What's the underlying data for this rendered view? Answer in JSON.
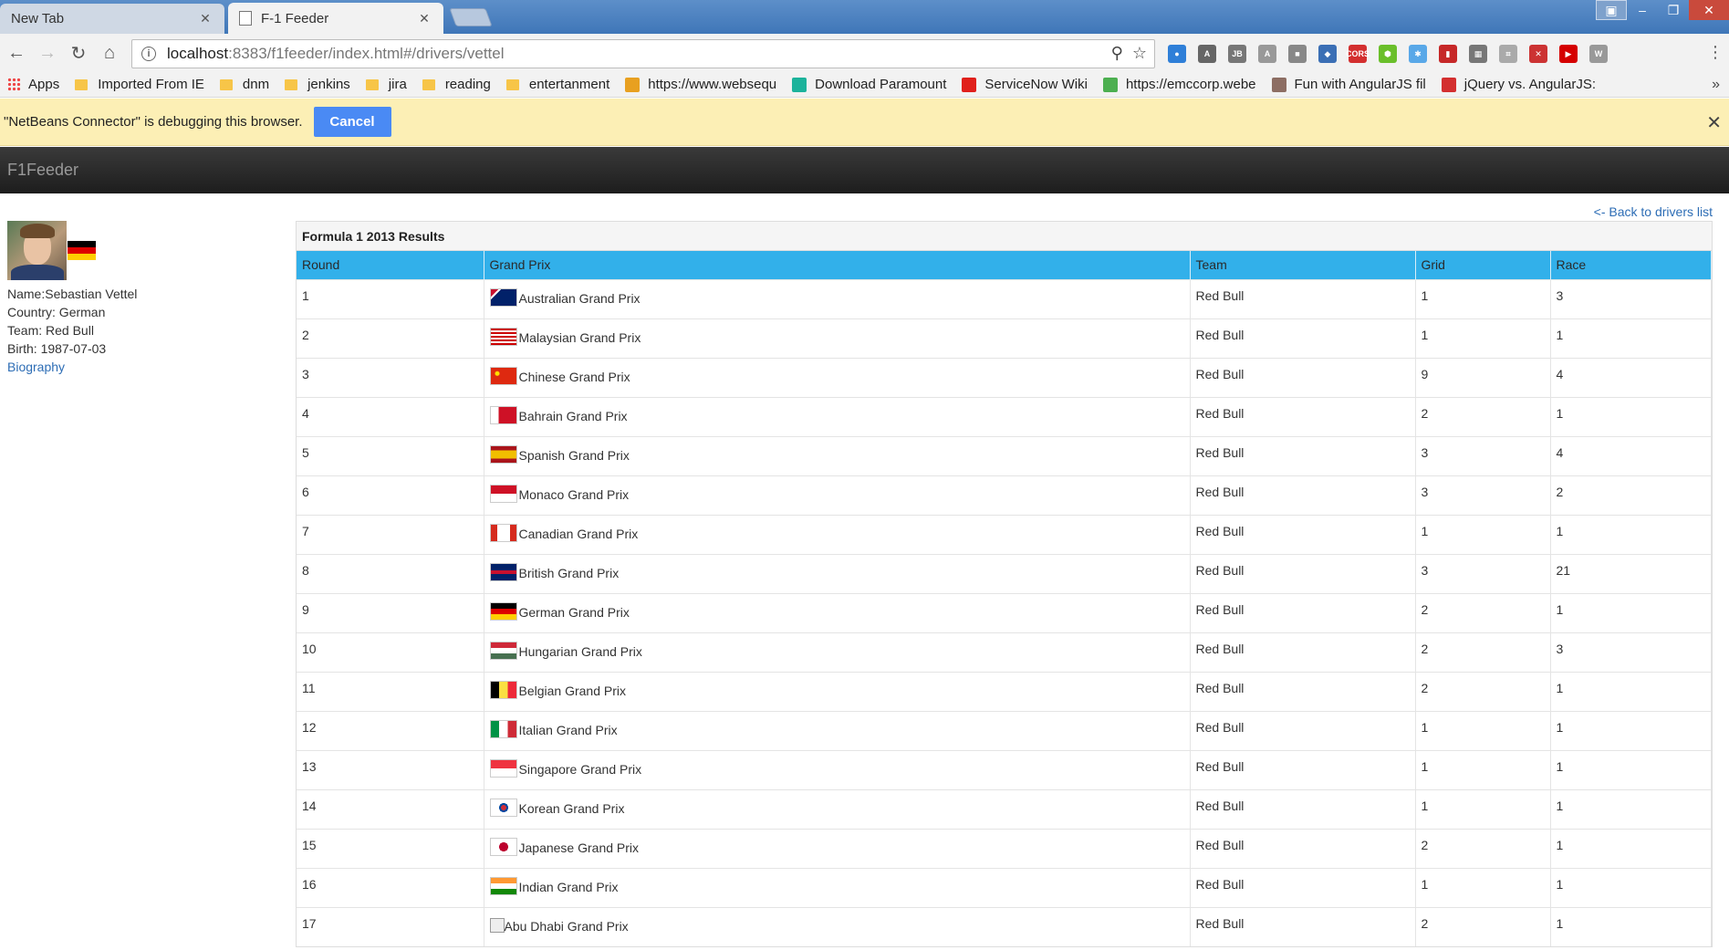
{
  "browser": {
    "tabs": [
      {
        "title": "New Tab",
        "active": false
      },
      {
        "title": "F-1 Feeder",
        "active": true
      }
    ],
    "url_host": "localhost",
    "url_rest": ":8383/f1feeder/index.html#/drivers/vettel",
    "bookmarks": [
      {
        "label": "Apps",
        "icon": "apps-icon"
      },
      {
        "label": "Imported From IE",
        "icon": "folder-icon"
      },
      {
        "label": "dnm",
        "icon": "folder-icon"
      },
      {
        "label": "jenkins",
        "icon": "folder-icon"
      },
      {
        "label": "jira",
        "icon": "folder-icon"
      },
      {
        "label": "reading",
        "icon": "folder-icon"
      },
      {
        "label": "entertanment",
        "icon": "folder-icon"
      },
      {
        "label": "https://www.websequ",
        "icon": "favicon",
        "color": "#e8a020"
      },
      {
        "label": "Download Paramount",
        "icon": "favicon",
        "color": "#1cb39b"
      },
      {
        "label": "ServiceNow Wiki",
        "icon": "favicon",
        "color": "#e0201b"
      },
      {
        "label": "https://emccorp.webe",
        "icon": "favicon",
        "color": "#4caf50"
      },
      {
        "label": "Fun with AngularJS fil",
        "icon": "favicon",
        "color": "#8d6e63"
      },
      {
        "label": "jQuery vs. AngularJS:",
        "icon": "favicon",
        "color": "#d32f2f"
      }
    ],
    "bookmarks_overflow": "»",
    "infobar_text": "\"NetBeans Connector\" is debugging this browser.",
    "infobar_cancel": "Cancel",
    "extensions": [
      {
        "name": "globe-ext-icon",
        "color": "#2f7fd8",
        "glyph": "●"
      },
      {
        "name": "angular-ext-icon",
        "color": "#666",
        "glyph": "A"
      },
      {
        "name": "jb-ext-icon",
        "color": "#777",
        "glyph": "JB"
      },
      {
        "name": "angular-gray-ext-icon",
        "color": "#999",
        "glyph": "A"
      },
      {
        "name": "square-ext-icon",
        "color": "#888",
        "glyph": "■"
      },
      {
        "name": "cube-ext-icon",
        "color": "#3b6fb5",
        "glyph": "◆"
      },
      {
        "name": "cors-ext-icon",
        "color": "#d32f2f",
        "glyph": "CORS"
      },
      {
        "name": "hex-ext-icon",
        "color": "#6abf2b",
        "glyph": "⬢"
      },
      {
        "name": "gear-ext-icon",
        "color": "#59a8e8",
        "glyph": "✱"
      },
      {
        "name": "book-ext-icon",
        "color": "#c62828",
        "glyph": "▮"
      },
      {
        "name": "grid-ext-icon",
        "color": "#777",
        "glyph": "▦"
      },
      {
        "name": "pdf-ext-icon",
        "color": "#aaa",
        "glyph": "⌗"
      },
      {
        "name": "block-ext-icon",
        "color": "#c33",
        "glyph": "✕"
      },
      {
        "name": "play-ext-icon",
        "color": "#d50000",
        "glyph": "▶"
      },
      {
        "name": "w-ext-icon",
        "color": "#999",
        "glyph": "W"
      }
    ]
  },
  "app": {
    "brand": "F1Feeder",
    "back_link": "<- Back to drivers list"
  },
  "driver": {
    "name_line": "Name:Sebastian Vettel",
    "country_line": "Country: German",
    "team_line": "Team: Red Bull",
    "birth_line": "Birth: 1987-07-03",
    "biography_link": "Biography"
  },
  "results": {
    "caption": "Formula 1 2013 Results",
    "columns": [
      "Round",
      "Grand Prix",
      "Team",
      "Grid",
      "Race"
    ],
    "rows": [
      {
        "round": "1",
        "gp": "Australian Grand Prix",
        "team": "Red Bull",
        "grid": "1",
        "race": "3",
        "flag": "australia"
      },
      {
        "round": "2",
        "gp": "Malaysian Grand Prix",
        "team": "Red Bull",
        "grid": "1",
        "race": "1",
        "flag": "malaysia"
      },
      {
        "round": "3",
        "gp": "Chinese Grand Prix",
        "team": "Red Bull",
        "grid": "9",
        "race": "4",
        "flag": "china"
      },
      {
        "round": "4",
        "gp": "Bahrain Grand Prix",
        "team": "Red Bull",
        "grid": "2",
        "race": "1",
        "flag": "bahrain"
      },
      {
        "round": "5",
        "gp": "Spanish Grand Prix",
        "team": "Red Bull",
        "grid": "3",
        "race": "4",
        "flag": "spain"
      },
      {
        "round": "6",
        "gp": "Monaco Grand Prix",
        "team": "Red Bull",
        "grid": "3",
        "race": "2",
        "flag": "monaco"
      },
      {
        "round": "7",
        "gp": "Canadian Grand Prix",
        "team": "Red Bull",
        "grid": "1",
        "race": "1",
        "flag": "canada"
      },
      {
        "round": "8",
        "gp": "British Grand Prix",
        "team": "Red Bull",
        "grid": "3",
        "race": "21",
        "flag": "uk"
      },
      {
        "round": "9",
        "gp": "German Grand Prix",
        "team": "Red Bull",
        "grid": "2",
        "race": "1",
        "flag": "germany"
      },
      {
        "round": "10",
        "gp": "Hungarian Grand Prix",
        "team": "Red Bull",
        "grid": "2",
        "race": "3",
        "flag": "hungary"
      },
      {
        "round": "11",
        "gp": "Belgian Grand Prix",
        "team": "Red Bull",
        "grid": "2",
        "race": "1",
        "flag": "belgium"
      },
      {
        "round": "12",
        "gp": "Italian Grand Prix",
        "team": "Red Bull",
        "grid": "1",
        "race": "1",
        "flag": "italy"
      },
      {
        "round": "13",
        "gp": "Singapore Grand Prix",
        "team": "Red Bull",
        "grid": "1",
        "race": "1",
        "flag": "singapore"
      },
      {
        "round": "14",
        "gp": "Korean Grand Prix",
        "team": "Red Bull",
        "grid": "1",
        "race": "1",
        "flag": "korea"
      },
      {
        "round": "15",
        "gp": "Japanese Grand Prix",
        "team": "Red Bull",
        "grid": "2",
        "race": "1",
        "flag": "japan"
      },
      {
        "round": "16",
        "gp": "Indian Grand Prix",
        "team": "Red Bull",
        "grid": "1",
        "race": "1",
        "flag": "india"
      },
      {
        "round": "17",
        "gp": "Abu Dhabi Grand Prix",
        "team": "Red Bull",
        "grid": "2",
        "race": "1",
        "flag": "broken"
      }
    ]
  }
}
